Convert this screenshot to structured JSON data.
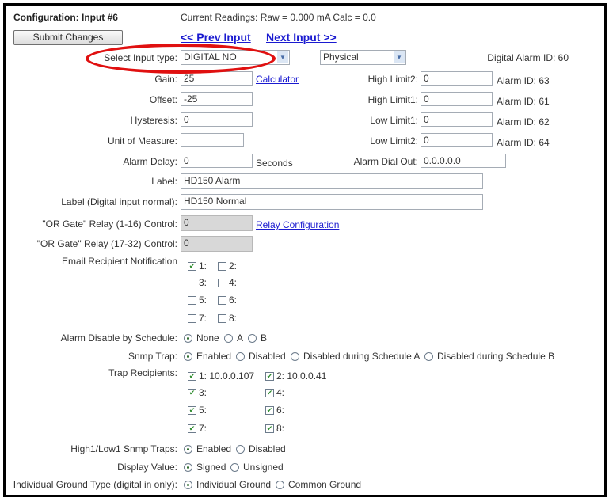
{
  "header": {
    "title": "Configuration: Input #6",
    "readings": "Current Readings: Raw = 0.000 mA Calc = 0.0",
    "submit": "Submit Changes",
    "prev": "<< Prev Input",
    "next": "Next Input >>"
  },
  "select": {
    "label": "Select Input type:",
    "input_type": "DIGITAL NO",
    "source": "Physical",
    "digital_alarm_id": "Digital Alarm ID: 60"
  },
  "left_fields": [
    {
      "label": "Gain:",
      "value": "25"
    },
    {
      "label": "Offset:",
      "value": "-25"
    },
    {
      "label": "Hysteresis:",
      "value": "0"
    },
    {
      "label": "Unit of Measure:",
      "value": ""
    },
    {
      "label": "Alarm Delay:",
      "value": "0"
    }
  ],
  "calculator": "Calculator",
  "seconds": "Seconds",
  "right_fields": [
    {
      "label": "High Limit2:",
      "value": "0",
      "alarm": "Alarm ID: 63"
    },
    {
      "label": "High Limit1:",
      "value": "0",
      "alarm": "Alarm ID: 61"
    },
    {
      "label": "Low Limit1:",
      "value": "0",
      "alarm": "Alarm ID: 62"
    },
    {
      "label": "Low Limit2:",
      "value": "0",
      "alarm": "Alarm ID: 64"
    },
    {
      "label": "Alarm Dial Out:",
      "value": "0.0.0.0.0"
    }
  ],
  "labels": {
    "label": "Label:",
    "label_value": "HD150 Alarm",
    "normal": "Label (Digital input normal):",
    "normal_value": "HD150 Normal"
  },
  "relay": {
    "r1": "\"OR Gate\" Relay (1-16) Control:",
    "r1_value": "0",
    "r2": "\"OR Gate\" Relay (17-32) Control:",
    "r2_value": "0",
    "config_link": "Relay Configuration"
  },
  "email": {
    "label": "Email Recipient Notification",
    "items": [
      {
        "label": "1:",
        "checked": true
      },
      {
        "label": "2:",
        "checked": false
      },
      {
        "label": "3:",
        "checked": false
      },
      {
        "label": "4:",
        "checked": false
      },
      {
        "label": "5:",
        "checked": false
      },
      {
        "label": "6:",
        "checked": false
      },
      {
        "label": "7:",
        "checked": false
      },
      {
        "label": "8:",
        "checked": false
      }
    ]
  },
  "schedule": {
    "label": "Alarm Disable by Schedule:",
    "options": [
      "None",
      "A",
      "B"
    ],
    "selected": "None"
  },
  "snmp": {
    "label": "Snmp Trap:",
    "options": [
      "Enabled",
      "Disabled",
      "Disabled during Schedule A",
      "Disabled during Schedule B"
    ],
    "selected": "Enabled"
  },
  "trap": {
    "label": "Trap Recipients:",
    "items": [
      {
        "label": "1: 10.0.0.107",
        "checked": true
      },
      {
        "label": "2: 10.0.0.41",
        "checked": true
      },
      {
        "label": "3:",
        "checked": true
      },
      {
        "label": "4:",
        "checked": true
      },
      {
        "label": "5:",
        "checked": true
      },
      {
        "label": "6:",
        "checked": true
      },
      {
        "label": "7:",
        "checked": true
      },
      {
        "label": "8:",
        "checked": true
      }
    ]
  },
  "hilo": {
    "label": "High1/Low1 Snmp Traps:",
    "options": [
      "Enabled",
      "Disabled"
    ],
    "selected": "Enabled"
  },
  "display": {
    "label": "Display Value:",
    "options": [
      "Signed",
      "Unsigned"
    ],
    "selected": "Signed"
  },
  "ground": {
    "label": "Individual Ground Type (digital in only):",
    "options": [
      "Individual Ground",
      "Common Ground"
    ],
    "selected": "Individual Ground"
  },
  "colors": {
    "highlight": "#e01010",
    "link": "#1a1ad0"
  }
}
